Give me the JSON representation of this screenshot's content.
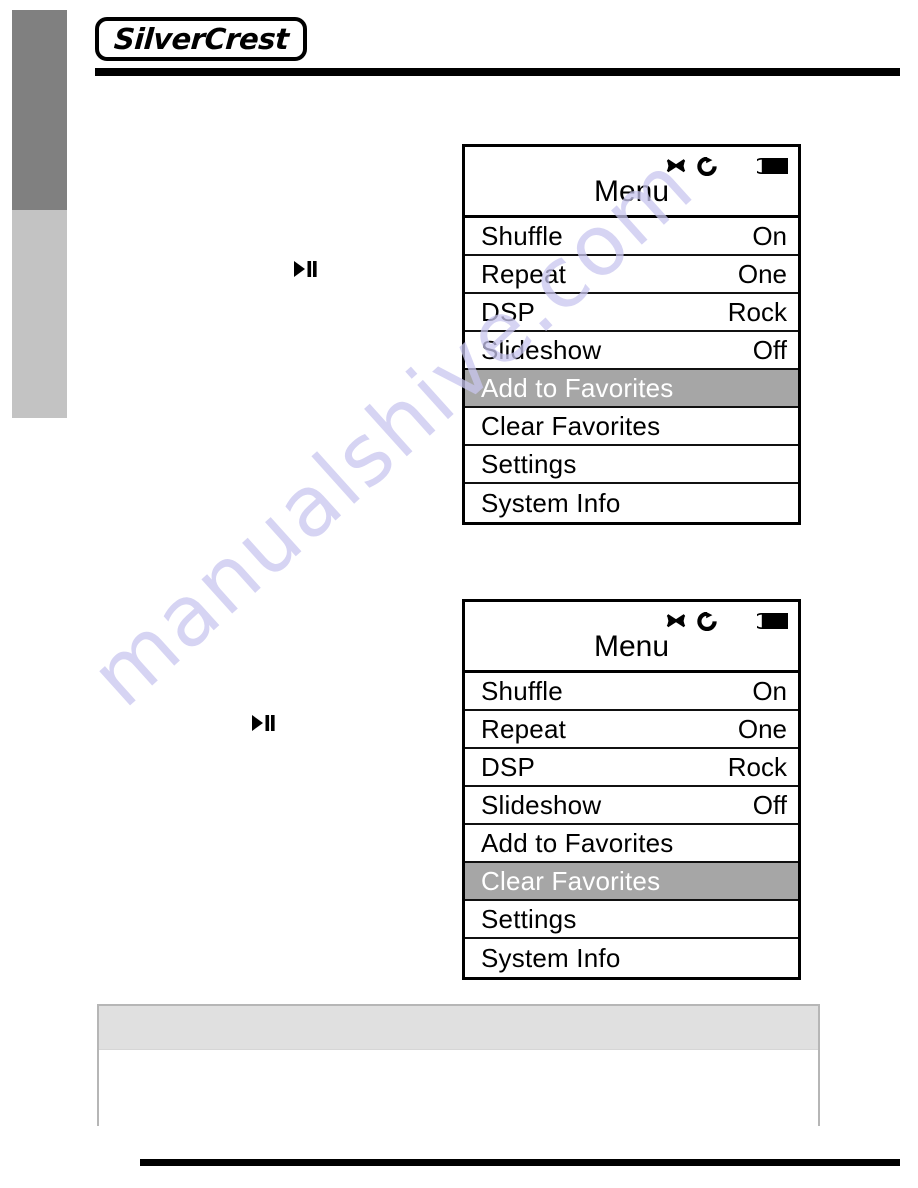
{
  "brand": {
    "logo_text": "SilverCrest"
  },
  "colors": {
    "sidebar_dark": "#808080",
    "sidebar_light": "#c3c3c3",
    "selection_background": "#a6a6a6",
    "selection_text": "#ffffff",
    "rule": "#000000",
    "note_header": "#e0e0e0",
    "note_border": "#b6b6b6",
    "watermark": "#c9c6ef"
  },
  "watermark": {
    "text": "manualshive.com"
  },
  "panels": [
    {
      "title": "Menu",
      "status_icons": [
        "shuffle-icon",
        "repeat-one-icon",
        "battery-icon"
      ],
      "selected_index": 4,
      "rows": [
        {
          "label": "Shuffle",
          "value": "On"
        },
        {
          "label": "Repeat",
          "value": "One"
        },
        {
          "label": "DSP",
          "value": "Rock"
        },
        {
          "label": "Slideshow",
          "value": "Off"
        },
        {
          "label": "Add to Favorites",
          "value": ""
        },
        {
          "label": "Clear Favorites",
          "value": ""
        },
        {
          "label": "Settings",
          "value": ""
        },
        {
          "label": "System Info",
          "value": ""
        }
      ]
    },
    {
      "title": "Menu",
      "status_icons": [
        "shuffle-icon",
        "repeat-one-icon",
        "battery-icon"
      ],
      "selected_index": 5,
      "rows": [
        {
          "label": "Shuffle",
          "value": "On"
        },
        {
          "label": "Repeat",
          "value": "One"
        },
        {
          "label": "DSP",
          "value": "Rock"
        },
        {
          "label": "Slideshow",
          "value": "Off"
        },
        {
          "label": "Add to Favorites",
          "value": ""
        },
        {
          "label": "Clear Favorites",
          "value": ""
        },
        {
          "label": "Settings",
          "value": ""
        },
        {
          "label": "System Info",
          "value": ""
        }
      ]
    }
  ],
  "markers": [
    {
      "icon": "play-pause-icon"
    },
    {
      "icon": "play-pause-icon"
    }
  ],
  "note_box": {
    "header_text": "",
    "body_text": ""
  }
}
